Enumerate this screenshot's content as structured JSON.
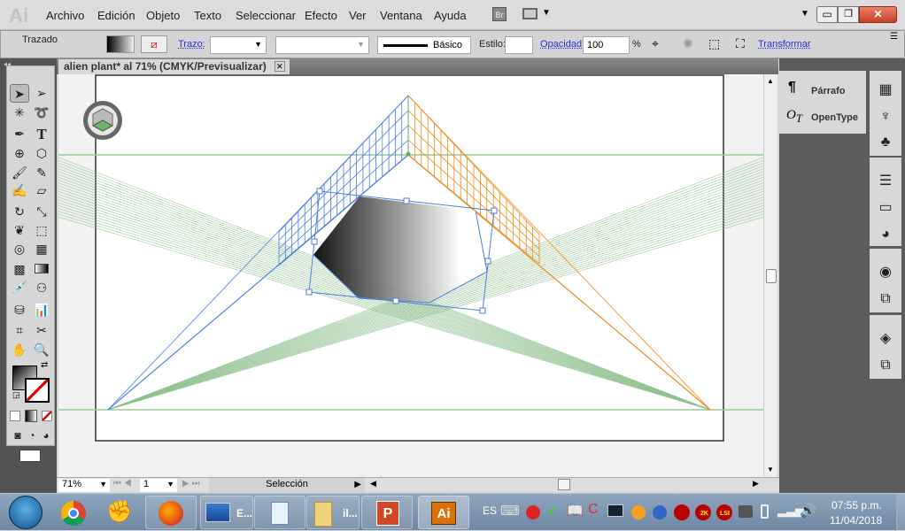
{
  "app": {
    "logo": "Ai",
    "menu": [
      "Archivo",
      "Edición",
      "Objeto",
      "Texto",
      "Seleccionar",
      "Efecto",
      "Ver",
      "Ventana",
      "Ayuda"
    ],
    "bridge": "Br"
  },
  "control": {
    "selection_label": "Trazado",
    "stroke_label": "Trazo:",
    "brush_label": "Básico",
    "style_label": "Estilo:",
    "opacity_label": "Opacidad:",
    "opacity_value": "100",
    "opacity_unit": "%",
    "transform_label": "Transformar"
  },
  "document": {
    "tab_title": "alien plant* al 71% (CMYK/Previsualizar)",
    "zoom": "71%",
    "artboard": "1",
    "status": "Selección"
  },
  "panels": {
    "items": [
      {
        "label": "Párrafo",
        "icon": "paragraph-icon"
      },
      {
        "label": "OpenType",
        "icon": "opentype-icon"
      }
    ]
  },
  "taskbar": {
    "apps": [
      "E...",
      "il..."
    ],
    "language": "ES",
    "time": "07:55 p.m.",
    "date": "11/04/2018",
    "badges": [
      "2K",
      "LSI"
    ]
  },
  "colors": {
    "left_grid": "#4a7fe8",
    "right_grid": "#f08a1c",
    "ground_grid": "#8fc08f",
    "selection": "#4f7fe0"
  }
}
